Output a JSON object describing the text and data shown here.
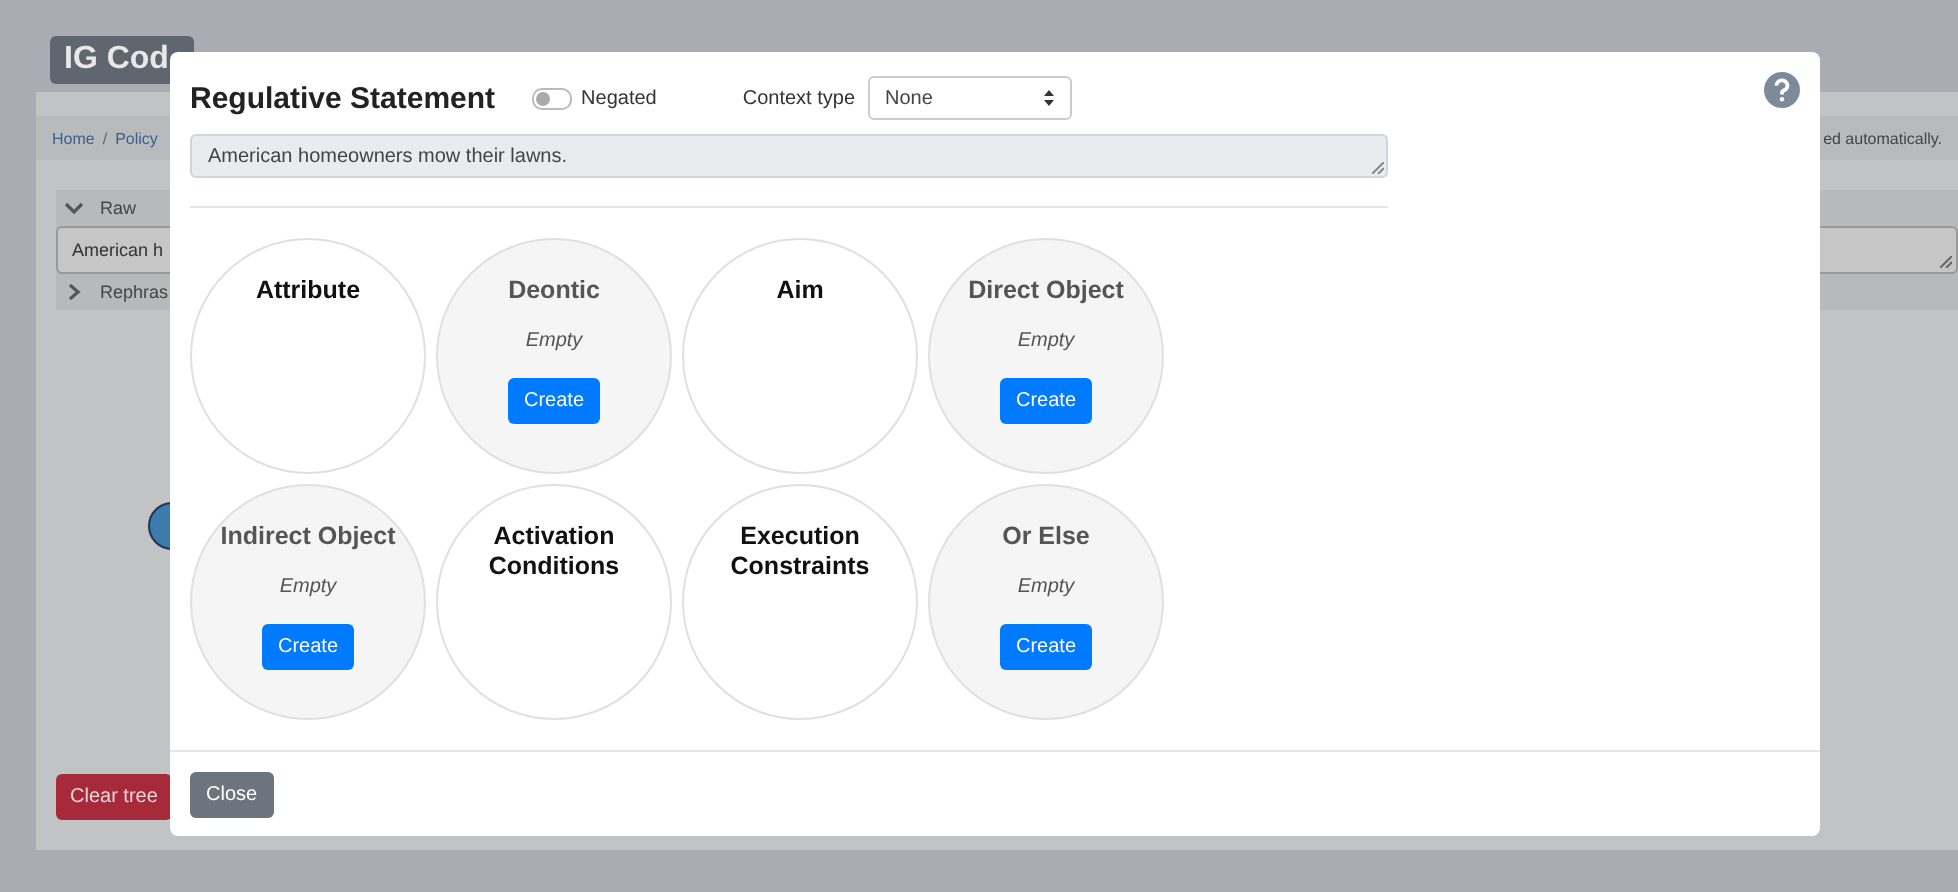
{
  "background": {
    "brand": "IG Cod",
    "breadcrumb": [
      {
        "label": "Home"
      },
      {
        "label": "Policy"
      }
    ],
    "separator": "/",
    "notice": "ed automatically.",
    "sections": [
      {
        "label": "Raw",
        "expanded": true,
        "value": "American h"
      },
      {
        "label": "Rephras",
        "expanded": false
      }
    ],
    "clear_button": "Clear tree"
  },
  "modal": {
    "title": "Regulative Statement",
    "negated": {
      "label": "Negated",
      "on": false
    },
    "context_type": {
      "label": "Context type",
      "value": "None"
    },
    "statement": "American homeowners mow their lawns.",
    "components": [
      {
        "name": "Attribute",
        "empty": false
      },
      {
        "name": "Deontic",
        "empty": true,
        "status": "Empty",
        "action": "Create"
      },
      {
        "name": "Aim",
        "empty": false
      },
      {
        "name": "Direct Object",
        "empty": true,
        "status": "Empty",
        "action": "Create"
      },
      {
        "name": "Indirect Object",
        "empty": true,
        "status": "Empty",
        "action": "Create"
      },
      {
        "name": "Activation Conditions",
        "empty": false
      },
      {
        "name": "Execution Constraints",
        "empty": false
      },
      {
        "name": "Or Else",
        "empty": true,
        "status": "Empty",
        "action": "Create"
      }
    ],
    "close_button": "Close"
  }
}
